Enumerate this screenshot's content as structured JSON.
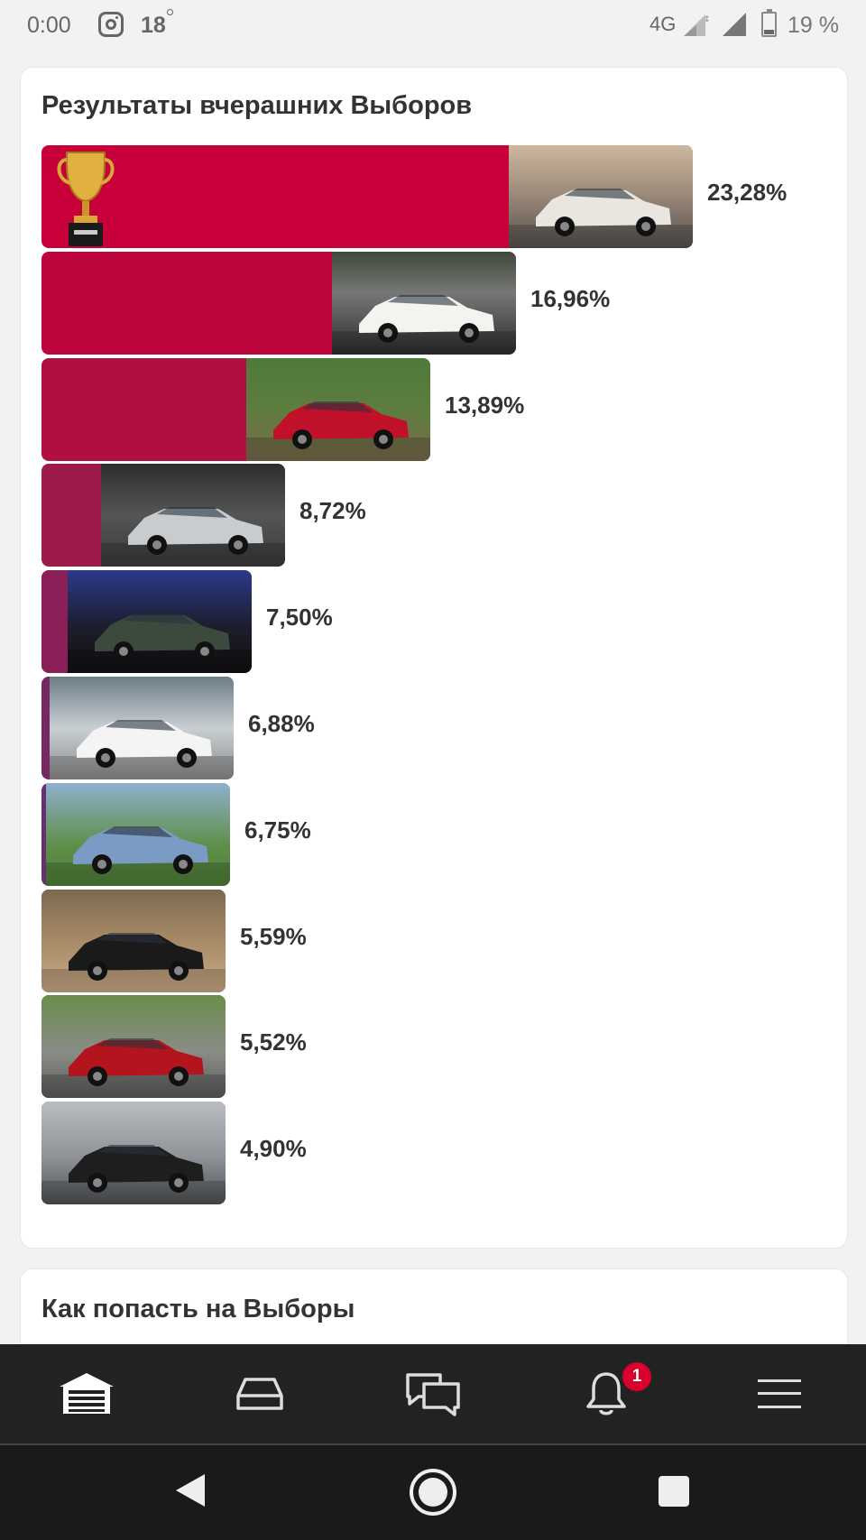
{
  "status_bar": {
    "time": "0:00",
    "temperature": "18",
    "network": "4G",
    "battery": "19 %",
    "icons": [
      "instagram-icon",
      "signal-icon",
      "battery-icon"
    ]
  },
  "results": {
    "title": "Результаты вчерашних Выборов",
    "bars": [
      {
        "percent": "23,28%",
        "value": 23.28,
        "color": "#c8003a"
      },
      {
        "percent": "16,96%",
        "value": 16.96,
        "color": "#be063c"
      },
      {
        "percent": "13,89%",
        "value": 13.89,
        "color": "#b0103f"
      },
      {
        "percent": "8,72%",
        "value": 8.72,
        "color": "#9c1b4b"
      },
      {
        "percent": "7,50%",
        "value": 7.5,
        "color": "#8b1f57"
      },
      {
        "percent": "6,88%",
        "value": 6.88,
        "color": "#762865"
      },
      {
        "percent": "6,75%",
        "value": 6.75,
        "color": "#64306f"
      },
      {
        "percent": "5,59%",
        "value": 5.59,
        "color": "#4a3875"
      },
      {
        "percent": "5,52%",
        "value": 5.52,
        "color": "#343f83"
      },
      {
        "percent": "4,90%",
        "value": 4.9,
        "color": "#1f4a93"
      }
    ]
  },
  "howto": {
    "title": "Как попасть на Выборы"
  },
  "nav": {
    "items": [
      "garage-icon",
      "car-icon",
      "messages-icon",
      "bell-icon",
      "menu-icon"
    ],
    "notification_count": "1"
  },
  "colors": {
    "accent": "#d8002d",
    "nav_bg": "#222222"
  }
}
